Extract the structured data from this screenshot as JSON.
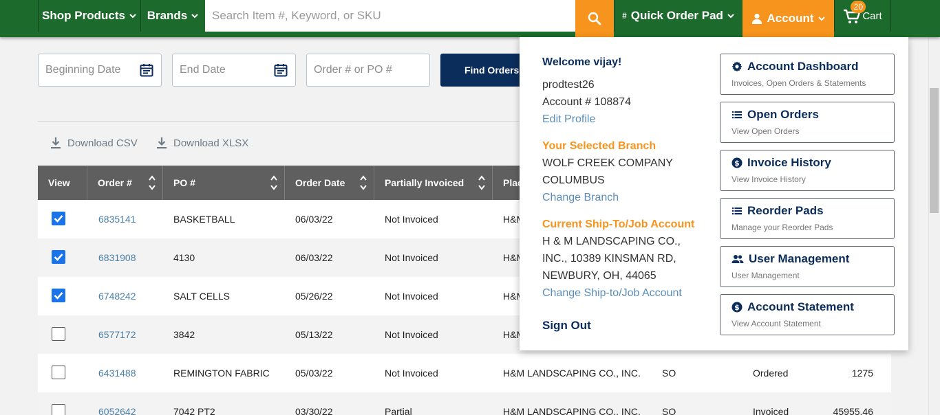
{
  "colors": {
    "nav_green": "#1c6b2c",
    "accent_orange": "#f7941d",
    "navy": "#0b2d5c",
    "link_blue": "#4a7fa8",
    "checkbox_blue": "#1a73e8"
  },
  "nav": {
    "shop_products": "Shop Products",
    "brands": "Brands",
    "search_placeholder": "Search Item #, Keyword, or SKU",
    "search_icon": "search-icon",
    "quick_order_pad": "Quick Order Pad",
    "account": "Account",
    "cart": "Cart",
    "cart_count": "20"
  },
  "filters": {
    "beginning_date_placeholder": "Beginning Date",
    "end_date_placeholder": "End Date",
    "order_po_placeholder": "Order # or PO #",
    "find_orders": "Find Orders"
  },
  "downloads": {
    "csv": "Download CSV",
    "xlsx": "Download XLSX"
  },
  "table": {
    "headers": [
      "View",
      "Order #",
      "PO #",
      "Order Date",
      "Partially Invoiced",
      "Plac"
    ],
    "rows": [
      {
        "checked": true,
        "order": "6835141",
        "po": "BASKETBALL",
        "date": "06/03/22",
        "invoiced": "Not Invoiced",
        "placed": "H&M",
        "type": "",
        "status": "",
        "amount": ""
      },
      {
        "checked": true,
        "order": "6831908",
        "po": "4130",
        "date": "06/03/22",
        "invoiced": "Not Invoiced",
        "placed": "H&M",
        "type": "",
        "status": "",
        "amount": ""
      },
      {
        "checked": true,
        "order": "6748242",
        "po": "SALT CELLS",
        "date": "05/26/22",
        "invoiced": "Not Invoiced",
        "placed": "H&M",
        "type": "",
        "status": "",
        "amount": ""
      },
      {
        "checked": false,
        "order": "6577172",
        "po": "3842",
        "date": "05/13/22",
        "invoiced": "Not Invoiced",
        "placed": "H&M",
        "type": "",
        "status": "",
        "amount": ""
      },
      {
        "checked": false,
        "order": "6431488",
        "po": "REMINGTON FABRIC",
        "date": "05/03/22",
        "invoiced": "Not Invoiced",
        "placed": "H&M LANDSCAPING CO., INC.",
        "type": "SO",
        "status": "Ordered",
        "amount": "1275"
      },
      {
        "checked": false,
        "order": "6052642",
        "po": "7042 PT2",
        "date": "03/30/22",
        "invoiced": "Partial",
        "placed": "H&M LANDSCAPING CO., INC.",
        "type": "SO",
        "status": "Invoiced",
        "amount": "45955.46"
      }
    ]
  },
  "account_menu": {
    "welcome": "Welcome vijay!",
    "username": "prodtest26",
    "account_number": "Account # 108874",
    "edit_profile": "Edit Profile",
    "branch_heading": "Your Selected Branch",
    "branch_line1": "WOLF CREEK COMPANY",
    "branch_line2": "COLUMBUS",
    "change_branch": "Change Branch",
    "shipto_heading": "Current Ship-To/Job Account",
    "shipto_line1": "H & M LANDSCAPING CO.,",
    "shipto_line2": "INC., 10389 KINSMAN RD,",
    "shipto_line3": "NEWBURY, OH, 44065",
    "change_shipto": "Change Ship-to/Job Account",
    "sign_out": "Sign Out",
    "cards": [
      {
        "icon": "gear-icon",
        "title": "Account Dashboard",
        "subtitle": "Invoices, Open Orders & Statements"
      },
      {
        "icon": "list-icon",
        "title": "Open Orders",
        "subtitle": "View Open Orders"
      },
      {
        "icon": "dollar-coin-icon",
        "title": "Invoice History",
        "subtitle": "View Invoice History"
      },
      {
        "icon": "list-icon",
        "title": "Reorder Pads",
        "subtitle": "Manage your Reorder Pads"
      },
      {
        "icon": "users-icon",
        "title": "User Management",
        "subtitle": "User Management"
      },
      {
        "icon": "dollar-coin-icon",
        "title": "Account Statement",
        "subtitle": "View Account Statement"
      }
    ]
  }
}
